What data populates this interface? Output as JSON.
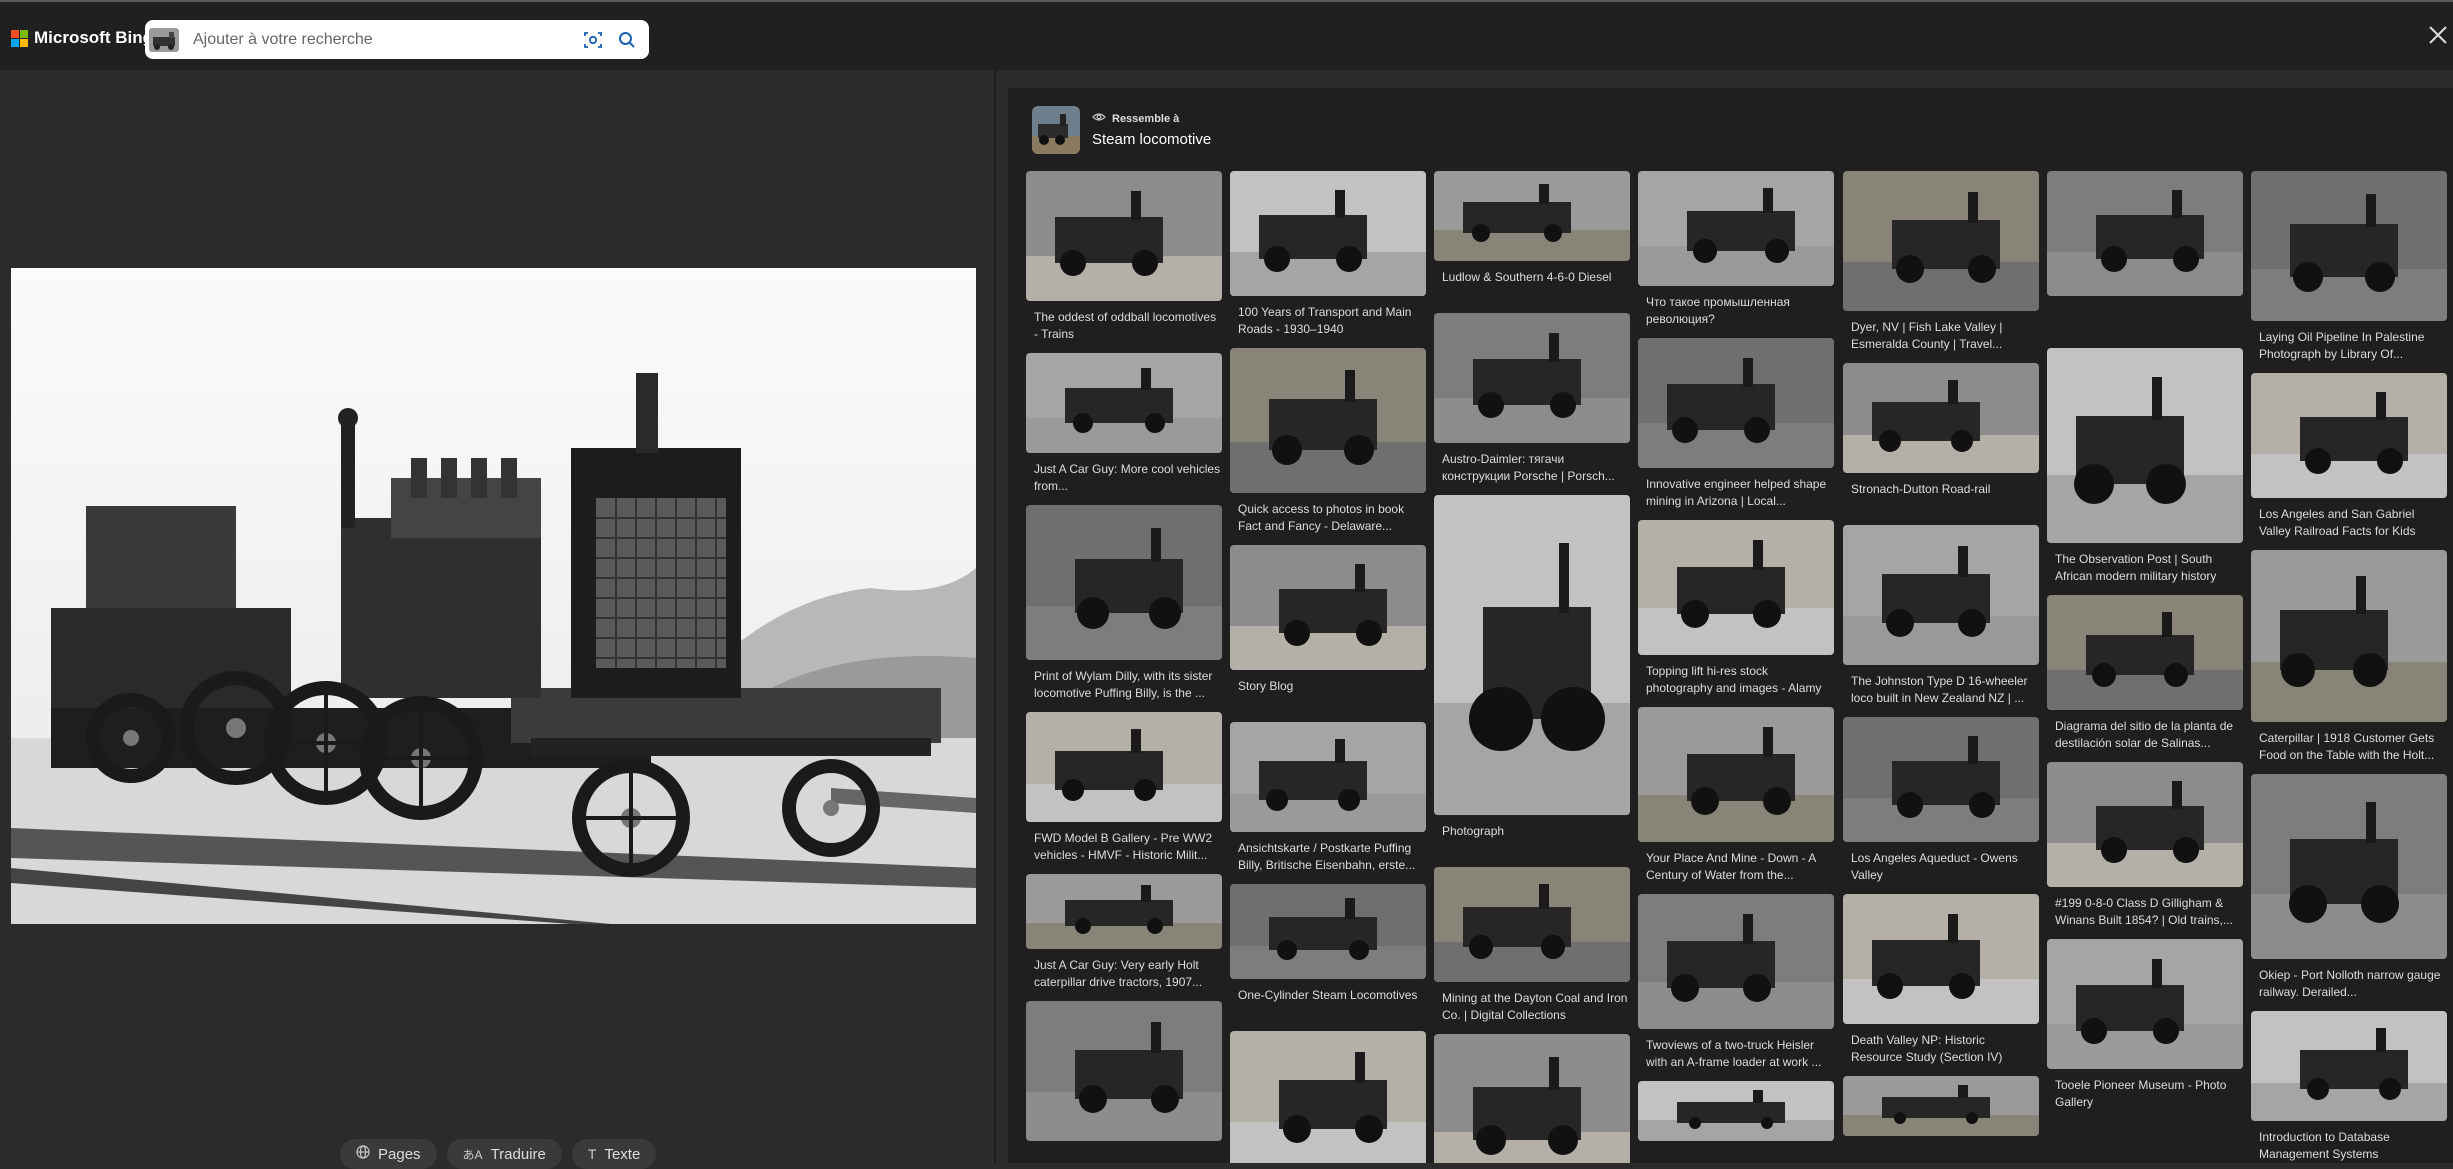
{
  "header": {
    "logo_text": "Microsoft Bing",
    "search_placeholder": "Ajouter à votre recherche",
    "brand_colors": [
      "#f25022",
      "#7fba00",
      "#00a4ef",
      "#ffb900"
    ]
  },
  "toolbar": {
    "pages_label": "Pages",
    "translate_label": "Traduire",
    "text_label": "Texte"
  },
  "resembles": {
    "label": "Ressemble à",
    "name": "Steam locomotive"
  },
  "results": [
    {
      "caption": "The oddest of oddball locomotives - Trains"
    },
    {
      "caption": "Just A Car Guy: More cool vehicles from..."
    },
    {
      "caption": "Print of Wylam Dilly, with its sister locomotive Puffing Billy, is the ..."
    },
    {
      "caption": "FWD Model B Gallery - Pre WW2 vehicles - HMVF - Historic Milit..."
    },
    {
      "caption": "Just A Car Guy: Very early Holt caterpillar drive tractors, 1907..."
    },
    {
      "caption": ""
    },
    {
      "caption": "100 Years of Transport and Main Roads - 1930–1940"
    },
    {
      "caption": "Quick access to photos in book Fact and Fancy - Delaware..."
    },
    {
      "caption": "Story Blog"
    },
    {
      "caption": "Ansichtskarte / Postkarte Puffing Billy, Britische Eisenbahn, erste..."
    },
    {
      "caption": "One-Cylinder Steam Locomotives"
    },
    {
      "caption": ""
    },
    {
      "caption": "Ludlow & Southern 4-6-0 Diesel"
    },
    {
      "caption": "Austro-Daimler: тягачи конструкции Porsche | Porsch..."
    },
    {
      "caption": "Photograph"
    },
    {
      "caption": "Mining at the Dayton Coal and Iron Co. | Digital Collections"
    },
    {
      "caption": ""
    },
    {
      "caption": "Что такое промышленная революция?"
    },
    {
      "caption": "Innovative engineer helped shape mining in Arizona | Local..."
    },
    {
      "caption": "Topping lift hi-res stock photography and images - Alamy"
    },
    {
      "caption": "Your Place And Mine - Down - A Century of Water from the..."
    },
    {
      "caption": "Twoviews of a two-truck Heisler with an A-frame loader at work ..."
    },
    {
      "caption": ""
    },
    {
      "caption": "Dyer, NV | Fish Lake Valley | Esmeralda County | Travel..."
    },
    {
      "caption": "Stronach-Dutton Road-rail"
    },
    {
      "caption": "The Johnston Type D 16-wheeler loco built in New Zealand NZ | ..."
    },
    {
      "caption": "Los Angeles Aqueduct - Owens Valley"
    },
    {
      "caption": "Death Valley NP: Historic Resource Study (Section IV)"
    },
    {
      "caption": ""
    },
    {
      "caption": ""
    },
    {
      "caption": "The Observation Post | South African modern military history"
    },
    {
      "caption": "Diagrama del sitio de la planta de destilación solar de Salinas..."
    },
    {
      "caption": "#199 0-8-0 Class D Gilligham & Winans Built 1854? | Old trains,..."
    },
    {
      "caption": "Tooele Pioneer Museum - Photo Gallery"
    },
    {
      "caption": "Laying Oil Pipeline In Palestine Photograph by Library Of..."
    },
    {
      "caption": "Los Angeles and San Gabriel Valley Railroad Facts for Kids"
    },
    {
      "caption": "Caterpillar | 1918 Customer Gets Food on the Table with the Holt..."
    },
    {
      "caption": "Okiep - Port Nolloth narrow gauge railway. Derailed..."
    },
    {
      "caption": "Introduction to Database Management Systems"
    },
    {
      "caption": ""
    }
  ]
}
